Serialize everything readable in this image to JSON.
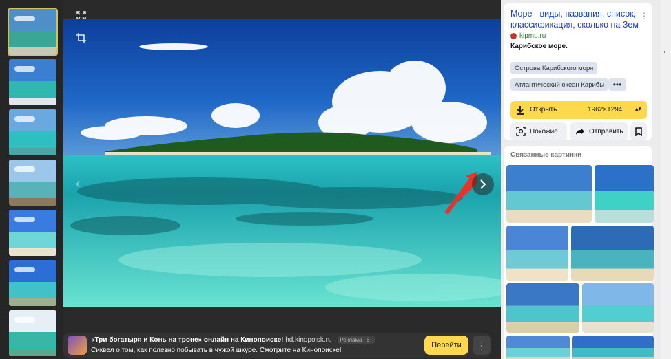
{
  "thumbnails": [
    {
      "sky": "#4f8fc8",
      "sea": "#3aa796",
      "sand": "#c8c9b5"
    },
    {
      "sky": "#3a7fd0",
      "sea": "#2fb7b0",
      "sand": "#dfe7ea"
    },
    {
      "sky": "#6aa9e0",
      "sea": "#2ec0c0",
      "sand": "#4aa7a6"
    },
    {
      "sky": "#9cc6ea",
      "sea": "#58b3b8",
      "sand": "#8b7a5e"
    },
    {
      "sky": "#3a7be0",
      "sea": "#6fd6d8",
      "sand": "#e9e4d2"
    },
    {
      "sky": "#2b6fd6",
      "sea": "#40c2c8",
      "sand": "#9bb08d"
    },
    {
      "sky": "#e6eef6",
      "sea": "#37b7a8",
      "sand": "#5aa78c"
    }
  ],
  "viewer": {
    "expand_icon": "expand-icon",
    "crop_icon": "crop-icon",
    "next_icon": "chevron-right-icon",
    "prev_icon": "chevron-left-icon"
  },
  "ad": {
    "title": "«Три богатыря и Конь на троне» онлайн на Кинопоиске!",
    "domain": "hd.kinopoisk.ru",
    "badge": "Реклама | 6+",
    "description": "Сиквел о том, как полезно побывать в чужой шкуре. Смотрите на Кинопоиске!",
    "button": "Перейти",
    "more": "⋮"
  },
  "panel": {
    "title": "Море - виды, названия, список, классификация, сколько на Зем",
    "site": "kipmu.ru",
    "snippet": "Карибское море.",
    "tags": [
      "Острова Карибского моря",
      "Атлантический океан Карибы"
    ],
    "tag_more": "•••",
    "open_label": "Открыть",
    "open_size": "1962×1294",
    "similar": "Похожие",
    "share": "Отправить",
    "related_title": "Связанные картинки"
  },
  "colors": {
    "accent": "#ffd84d",
    "link": "#1a3fcf",
    "site": "#2b7a2b"
  }
}
